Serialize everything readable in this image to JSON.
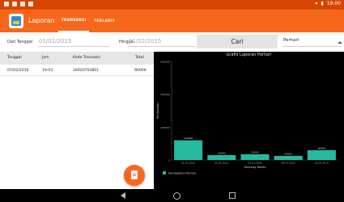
{
  "status_bar": {
    "time": "19:00"
  },
  "app": {
    "title": "Laporan",
    "tabs": [
      {
        "label": "Transaksi"
      },
      {
        "label": "Terlaris"
      }
    ]
  },
  "filter": {
    "from_label": "Dari Tanggal",
    "from_value": "01/01/2015",
    "to_label": "Hingga",
    "to_value": "31/02/2015",
    "search_button": "Cari",
    "period_select": "Perhari"
  },
  "table": {
    "headers": [
      "Tanggal",
      "Jam",
      "Kode Transaksi",
      "Total"
    ],
    "rows": [
      [
        "07/02/2016",
        "19:03",
        "16020703801",
        "90000"
      ]
    ]
  },
  "chart_data": {
    "type": "bar",
    "title": "Grafik Laporan Perhari",
    "xlabel": "Rentang Waktu",
    "ylabel": "Pendapatan",
    "categories": [
      "01.01.2015",
      "02.01.2015",
      "03.01.2015",
      "04.01.2015",
      "05.01.2015"
    ],
    "series": [
      {
        "name": "Pendapatan Perhari",
        "values": [
          120000,
          30000,
          35000,
          25000,
          60000
        ]
      }
    ],
    "ylim": [
      0,
      600000
    ],
    "yticks": [
      0,
      200000,
      400000,
      600000
    ],
    "bar_color": "#26b9a0",
    "legend": "bottom-left"
  },
  "colors": {
    "accent": "#f7671b",
    "status_bar": "#d84500"
  },
  "icons": {
    "fab": "report-icon",
    "nav": [
      "back-icon",
      "home-icon",
      "recent-apps-icon"
    ]
  }
}
